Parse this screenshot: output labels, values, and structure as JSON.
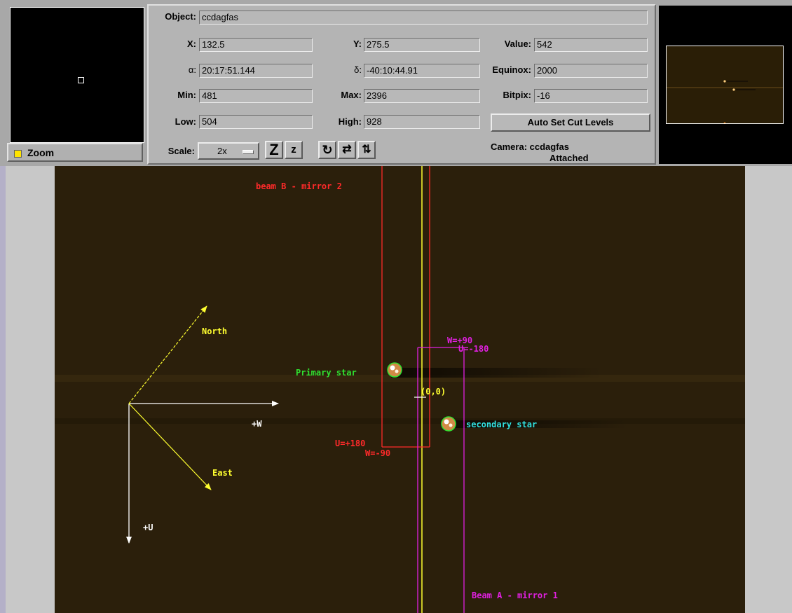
{
  "zoom": {
    "label": "Zoom",
    "checked": true
  },
  "fields": {
    "object": {
      "label": "Object:",
      "value": "ccdagfas"
    },
    "x": {
      "label": "X:",
      "value": "132.5"
    },
    "y": {
      "label": "Y:",
      "value": "275.5"
    },
    "value": {
      "label": "Value:",
      "value": "542"
    },
    "alpha": {
      "label": "α:",
      "value": "20:17:51.144"
    },
    "delta": {
      "label": "δ:",
      "value": "-40:10:44.91"
    },
    "equinox": {
      "label": "Equinox:",
      "value": "2000"
    },
    "min": {
      "label": "Min:",
      "value": "481"
    },
    "max": {
      "label": "Max:",
      "value": "2396"
    },
    "bitpix": {
      "label": "Bitpix:",
      "value": "-16"
    },
    "low": {
      "label": "Low:",
      "value": "504"
    },
    "high": {
      "label": "High:",
      "value": "928"
    }
  },
  "auto_cut_label": "Auto Set Cut Levels",
  "scale": {
    "label": "Scale:",
    "value": "2x"
  },
  "toolbar": {
    "zoom_in_glyph": "Z",
    "zoom_out_glyph": "z",
    "rotate_glyph": "↻",
    "flip_x_glyph": "⇄",
    "flip_y_glyph": "⇅"
  },
  "camera": {
    "label": "Camera:",
    "name": "ccdagfas",
    "status": "Attached"
  },
  "overlay": {
    "beam_b": "beam B - mirror 2",
    "beam_a": "Beam A - mirror 1",
    "north": "North",
    "east": "East",
    "plus_w": "+W",
    "plus_u": "+U",
    "primary": "Primary star",
    "secondary": "secondary star",
    "origin": "(0,0)",
    "w_plus90": "W=+90",
    "u_minus180": "U=-180",
    "u_plus180": "U=+180",
    "w_minus90": "W=-90"
  },
  "colors": {
    "beam_b": "#ff2a2a",
    "beam_a": "#e020e0",
    "axes": "#ffffff",
    "compass": "#ffff30",
    "primary_text": "#30e030",
    "secondary_text": "#30e0e0",
    "guide_line": "#ffff30",
    "image_bg": "#2b1f0b"
  }
}
